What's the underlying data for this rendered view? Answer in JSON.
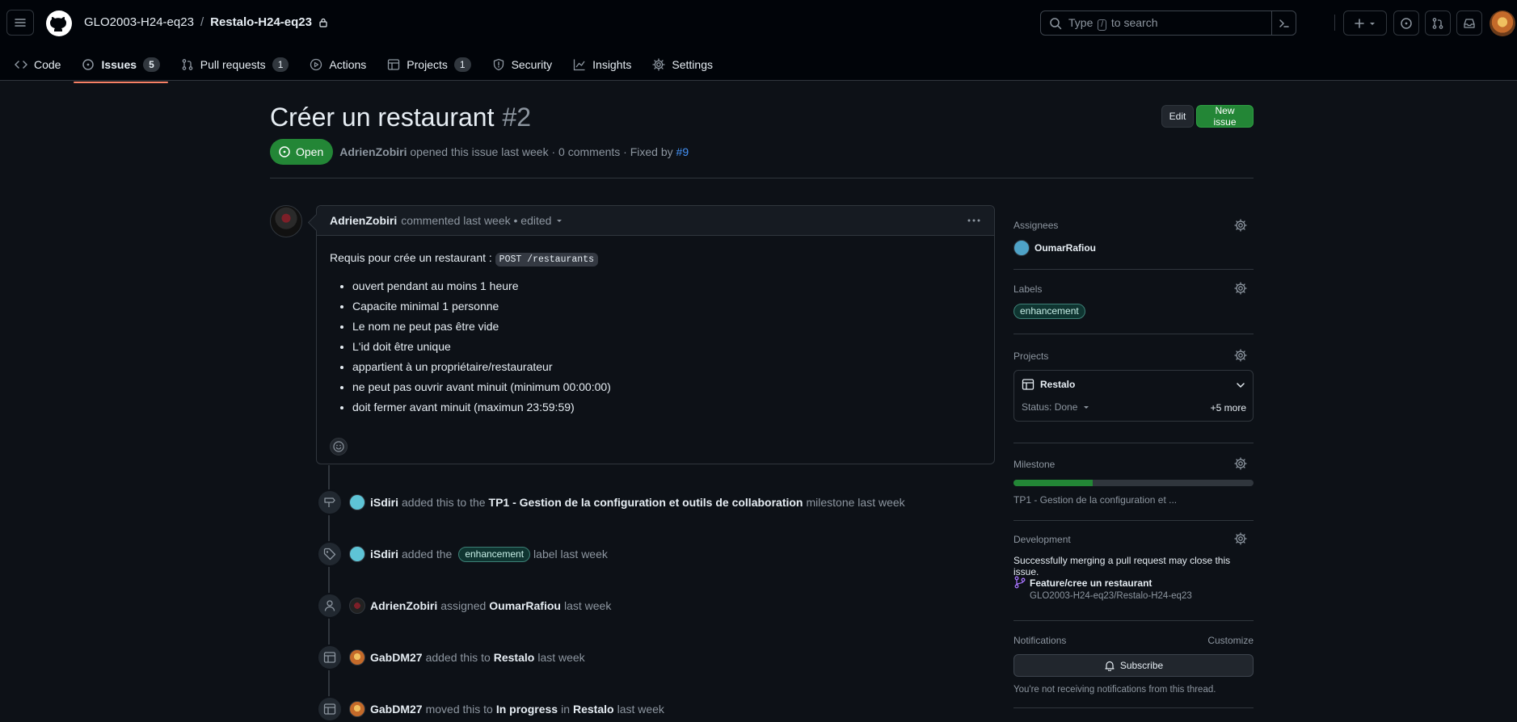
{
  "header": {
    "owner": "GLO2003-H24-eq23",
    "separator": "/",
    "repo": "Restalo-H24-eq23",
    "search_before": "Type",
    "search_key": "/",
    "search_after": "to search"
  },
  "tabs": [
    {
      "label": "Code",
      "icon": "code-icon"
    },
    {
      "label": "Issues",
      "count": "5",
      "icon": "issue-opened-icon",
      "active": true
    },
    {
      "label": "Pull requests",
      "count": "1",
      "icon": "git-pull-request-icon"
    },
    {
      "label": "Actions",
      "icon": "play-icon"
    },
    {
      "label": "Projects",
      "count": "1",
      "icon": "table-icon"
    },
    {
      "label": "Security",
      "icon": "shield-icon"
    },
    {
      "label": "Insights",
      "icon": "graph-icon"
    },
    {
      "label": "Settings",
      "icon": "gear-icon"
    }
  ],
  "issue": {
    "title": "Créer un restaurant",
    "number": "#2",
    "edit_label": "Edit",
    "new_issue_label": "New issue",
    "state": "Open",
    "author": "AdrienZobiri",
    "opened_text": "opened this issue last week · 0 comments · Fixed by",
    "fixed_by": "#9"
  },
  "comment": {
    "author": "AdrienZobiri",
    "meta": "commented last week • edited",
    "intro": "Requis pour crée un restaurant :",
    "code": "POST /restaurants",
    "items": [
      "ouvert pendant au moins 1 heure",
      "Capacite minimal 1 personne",
      "Le nom ne peut pas être vide",
      "L'id doit être unique",
      "appartient à un propriétaire/restaurateur",
      "ne peut pas ouvrir avant minuit (minimum 00:00:00)",
      "doit fermer avant minuit (maximun 23:59:59)"
    ]
  },
  "timeline": [
    {
      "icon": "milestone-icon",
      "actor": "iSdiri",
      "before": "added this to the",
      "target": "TP1 - Gestion de la configuration et outils de collaboration",
      "after": "milestone last week"
    },
    {
      "icon": "tag-icon",
      "actor": "iSdiri",
      "before": "added the",
      "label": "enhancement",
      "after": "label last week"
    },
    {
      "icon": "person-icon",
      "actor": "AdrienZobiri",
      "before": "assigned",
      "target": "OumarRafiou",
      "after": "last week"
    },
    {
      "icon": "table-icon",
      "actor": "GabDM27",
      "before": "added this to",
      "target": "Restalo",
      "after": "last week"
    },
    {
      "icon": "table-icon",
      "actor": "GabDM27",
      "before": "moved this to",
      "target": "In progress",
      "middle": "in",
      "target2": "Restalo",
      "after": "last week"
    }
  ],
  "sidebar": {
    "assignees_title": "Assignees",
    "assignee": "OumarRafiou",
    "labels_title": "Labels",
    "label": "enhancement",
    "projects_title": "Projects",
    "project_name": "Restalo",
    "project_status": "Status: Done",
    "project_more": "+5 more",
    "milestone_title": "Milestone",
    "milestone_progress": 0.33,
    "milestone_name": "TP1 - Gestion de la configuration et ...",
    "development_title": "Development",
    "development_text": "Successfully merging a pull request may close this issue.",
    "branch_name": "Feature/cree un restaurant",
    "branch_repo": "GLO2003-H24-eq23/Restalo-H24-eq23",
    "notifications_title": "Notifications",
    "customize_label": "Customize",
    "subscribe_label": "Subscribe",
    "notifications_note": "You're not receiving notifications from this thread."
  },
  "colors": {
    "accent_green": "#238636",
    "link_blue": "#4493f8",
    "tab_underline": "#f78166"
  }
}
